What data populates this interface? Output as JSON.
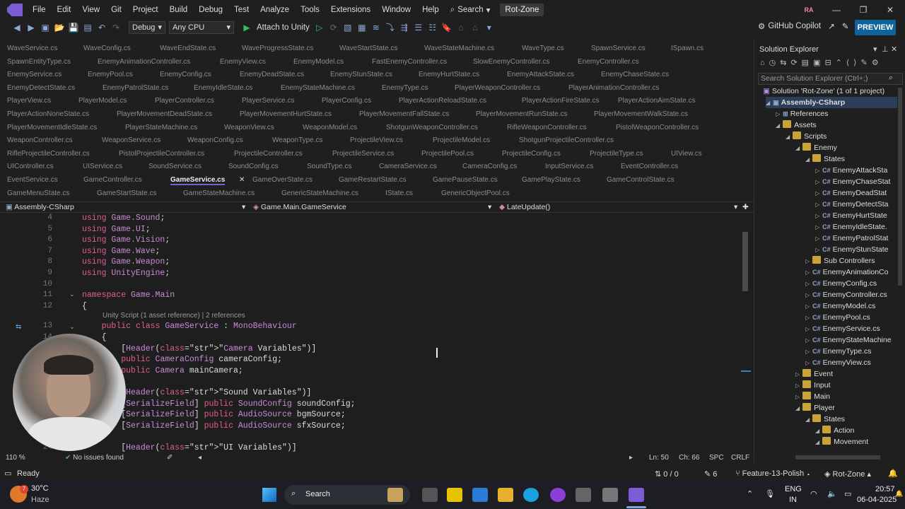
{
  "menubar": {
    "items": [
      "File",
      "Edit",
      "View",
      "Git",
      "Project",
      "Build",
      "Debug",
      "Test",
      "Analyze",
      "Tools",
      "Extensions",
      "Window",
      "Help"
    ],
    "search": "Search",
    "app_name": "Rot-Zone",
    "avatar": "RA"
  },
  "toolbar": {
    "config": "Debug",
    "platform": "Any CPU",
    "attach": "Attach to Unity",
    "copilot": "GitHub Copilot",
    "preview": "PREVIEW"
  },
  "tabs": [
    [
      "WaveService.cs",
      "WaveConfig.cs",
      "WaveEndState.cs",
      "WaveProgressState.cs",
      "WaveStartState.cs",
      "WaveStateMachine.cs",
      "WaveType.cs",
      "SpawnService.cs",
      "ISpawn.cs"
    ],
    [
      "SpawnEntityType.cs",
      "EnemyAnimationController.cs",
      "EnemyView.cs",
      "EnemyModel.cs",
      "FastEnemyController.cs",
      "SlowEnemyController.cs",
      "EnemyController.cs"
    ],
    [
      "EnemyService.cs",
      "EnemyPool.cs",
      "EnemyConfig.cs",
      "EnemyDeadState.cs",
      "EnemyStunState.cs",
      "EnemyHurtState.cs",
      "EnemyAttackState.cs",
      "EnemyChaseState.cs"
    ],
    [
      "EnemyDetectState.cs",
      "EnemyPatrolState.cs",
      "EnemyIdleState.cs",
      "EnemyStateMachine.cs",
      "EnemyType.cs",
      "PlayerWeaponController.cs",
      "PlayerAnimationController.cs"
    ],
    [
      "PlayerView.cs",
      "PlayerModel.cs",
      "PlayerController.cs",
      "PlayerService.cs",
      "PlayerConfig.cs",
      "PlayerActionReloadState.cs",
      "PlayerActionFireState.cs",
      "PlayerActionAimState.cs"
    ],
    [
      "PlayerActionNoneState.cs",
      "PlayerMovementDeadState.cs",
      "PlayerMovementHurtState.cs",
      "PlayerMovementFallState.cs",
      "PlayerMovementRunState.cs",
      "PlayerMovementWalkState.cs"
    ],
    [
      "PlayerMovementIdleState.cs",
      "PlayerStateMachine.cs",
      "WeaponView.cs",
      "WeaponModel.cs",
      "ShotgunWeaponController.cs",
      "RifleWeaponController.cs",
      "PistolWeaponController.cs"
    ],
    [
      "WeaponController.cs",
      "WeaponService.cs",
      "WeaponConfig.cs",
      "WeaponType.cs",
      "ProjectileView.cs",
      "ProjectileModel.cs",
      "ShotgunProjectileController.cs"
    ],
    [
      "RifleProjectileController.cs",
      "PistolProjectileController.cs",
      "ProjectileController.cs",
      "ProjectileService.cs",
      "ProjectilePool.cs",
      "ProjectileConfig.cs",
      "ProjectileType.cs",
      "UIView.cs"
    ],
    [
      "UIController.cs",
      "UIService.cs",
      "SoundService.cs",
      "SoundConfig.cs",
      "SoundType.cs",
      "CameraService.cs",
      "CameraConfig.cs",
      "InputService.cs",
      "EventController.cs"
    ],
    [
      "EventService.cs",
      "GameController.cs",
      "GameService.cs",
      "GameOverState.cs",
      "GameRestartState.cs",
      "GamePauseState.cs",
      "GamePlayState.cs",
      "GameControlState.cs"
    ],
    [
      "GameMenuState.cs",
      "GameStartState.cs",
      "GameStateMachine.cs",
      "GenericStateMachine.cs",
      "IState.cs",
      "GenericObjectPool.cs"
    ]
  ],
  "navbar": {
    "project": "Assembly-CSharp",
    "type": "Game.Main.GameService",
    "member": "LateUpdate()"
  },
  "code": {
    "hint": "Unity Script (1 asset reference) | 2 references",
    "lines": [
      {
        "n": "4",
        "t": "using Game.Sound;"
      },
      {
        "n": "5",
        "t": "using Game.UI;"
      },
      {
        "n": "6",
        "t": "using Game.Vision;"
      },
      {
        "n": "7",
        "t": "using Game.Wave;"
      },
      {
        "n": "8",
        "t": "using Game.Weapon;"
      },
      {
        "n": "9",
        "t": "using UnityEngine;"
      },
      {
        "n": "10",
        "t": ""
      },
      {
        "n": "11",
        "t": "namespace Game.Main"
      },
      {
        "n": "12",
        "t": "{"
      },
      {
        "n": "13",
        "t": "    public class GameService : MonoBehaviour"
      },
      {
        "n": "14",
        "t": "    {"
      },
      {
        "n": "15",
        "t": "        [Header(\"Camera Variables\")]"
      },
      {
        "n": "16",
        "t": "        public CameraConfig cameraConfig;"
      },
      {
        "n": "17",
        "t": "        public Camera mainCamera;"
      },
      {
        "n": "18",
        "t": ""
      },
      {
        "n": "19",
        "t": "        [Header(\"Sound Variables\")]"
      },
      {
        "n": "20",
        "t": "        [SerializeField] public SoundConfig soundConfig;"
      },
      {
        "n": "21",
        "t": "        [SerializeField] public AudioSource bgmSource;"
      },
      {
        "n": "22",
        "t": "        [SerializeField] public AudioSource sfxSource;"
      },
      {
        "n": "23",
        "t": ""
      },
      {
        "n": "24",
        "t": "        [Header(\"UI Variables\")]"
      }
    ]
  },
  "editor_status": {
    "zoom": "110 %",
    "issues": "No issues found",
    "ln": "Ln: 50",
    "ch": "Ch: 66",
    "spc": "SPC",
    "crlf": "CRLF"
  },
  "solution": {
    "title": "Solution Explorer",
    "search_placeholder": "Search Solution Explorer (Ctrl+;)",
    "root": "Solution 'Rot-Zone' (1 of 1 project)",
    "items": [
      {
        "label": "Assembly-CSharp",
        "kind": "project",
        "indent": 1
      },
      {
        "label": "References",
        "kind": "refs",
        "indent": 2
      },
      {
        "label": "Assets",
        "kind": "folder",
        "indent": 2
      },
      {
        "label": "Scripts",
        "kind": "folder",
        "indent": 3
      },
      {
        "label": "Enemy",
        "kind": "folder",
        "indent": 4
      },
      {
        "label": "States",
        "kind": "folder",
        "indent": 5
      },
      {
        "label": "EnemyAttackSta",
        "kind": "cs",
        "indent": 6
      },
      {
        "label": "EnemyChaseStat",
        "kind": "cs",
        "indent": 6
      },
      {
        "label": "EnemyDeadStat",
        "kind": "cs",
        "indent": 6
      },
      {
        "label": "EnemyDetectSta",
        "kind": "cs",
        "indent": 6
      },
      {
        "label": "EnemyHurtState",
        "kind": "cs",
        "indent": 6
      },
      {
        "label": "EnemyIdleState.",
        "kind": "cs",
        "indent": 6
      },
      {
        "label": "EnemyPatrolStat",
        "kind": "cs",
        "indent": 6
      },
      {
        "label": "EnemyStunState",
        "kind": "cs",
        "indent": 6
      },
      {
        "label": "Sub Controllers",
        "kind": "folder",
        "indent": 5
      },
      {
        "label": "EnemyAnimationCo",
        "kind": "cs",
        "indent": 5
      },
      {
        "label": "EnemyConfig.cs",
        "kind": "cs",
        "indent": 5
      },
      {
        "label": "EnemyController.cs",
        "kind": "cs",
        "indent": 5
      },
      {
        "label": "EnemyModel.cs",
        "kind": "cs",
        "indent": 5
      },
      {
        "label": "EnemyPool.cs",
        "kind": "cs",
        "indent": 5
      },
      {
        "label": "EnemyService.cs",
        "kind": "cs",
        "indent": 5
      },
      {
        "label": "EnemyStateMachine",
        "kind": "cs",
        "indent": 5
      },
      {
        "label": "EnemyType.cs",
        "kind": "cs",
        "indent": 5
      },
      {
        "label": "EnemyView.cs",
        "kind": "cs",
        "indent": 5
      },
      {
        "label": "Event",
        "kind": "folder",
        "indent": 4
      },
      {
        "label": "Input",
        "kind": "folder",
        "indent": 4
      },
      {
        "label": "Main",
        "kind": "folder",
        "indent": 4
      },
      {
        "label": "Player",
        "kind": "folder",
        "indent": 4
      },
      {
        "label": "States",
        "kind": "folder",
        "indent": 5
      },
      {
        "label": "Action",
        "kind": "folder",
        "indent": 6
      },
      {
        "label": "Movement",
        "kind": "folder",
        "indent": 6
      }
    ]
  },
  "bottom_status": {
    "ready": "Ready",
    "updown": "0 / 0",
    "pencil": "6",
    "branch": "Feature-13-Polish",
    "repo": "Rot-Zone"
  },
  "taskbar": {
    "temp": "30°C",
    "weather": "Haze",
    "search": "Search",
    "lang": "ENG",
    "region": "IN",
    "time": "20:57",
    "date": "06-04-2025",
    "weather_badge": "7"
  }
}
